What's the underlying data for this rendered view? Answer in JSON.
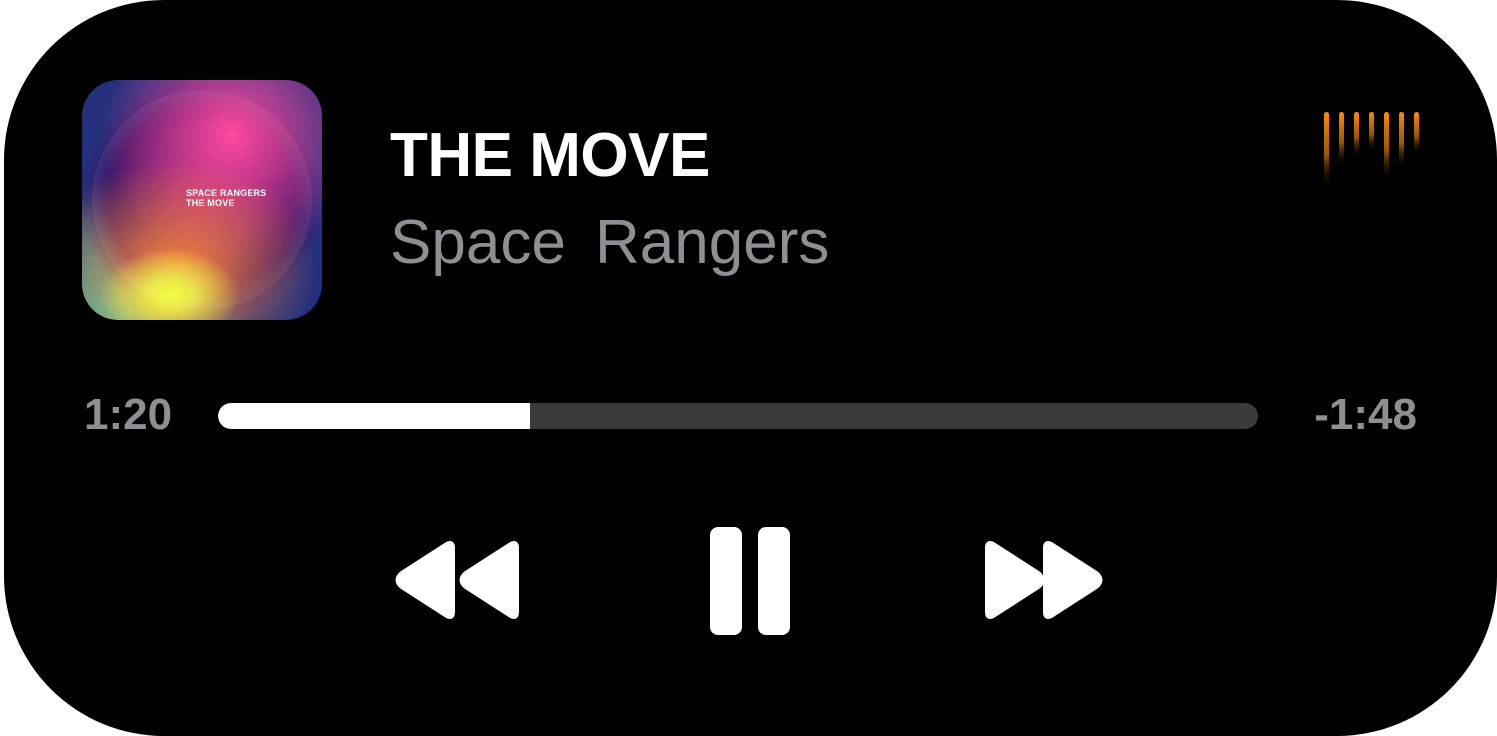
{
  "now_playing": {
    "title": "THE MOVE",
    "artist": "Space Rangers",
    "artwork": {
      "line1": "SPACE RANGERS",
      "line2": "THE MOVE"
    }
  },
  "playback": {
    "elapsed": "1:20",
    "remaining": "-1:48",
    "progress_fraction": 0.3,
    "state": "playing"
  },
  "controls": {
    "rewind_icon": "rewind-icon",
    "pause_icon": "pause-icon",
    "forward_icon": "fast-forward-icon",
    "audio_indicator_icon": "waveform-icon"
  },
  "colors": {
    "background": "#000000",
    "title": "#ffffff",
    "secondary": "#8e8e93",
    "progress_fill": "#ffffff",
    "progress_track": "#3a3a3c",
    "waveform_accent": "#ff8c00"
  }
}
